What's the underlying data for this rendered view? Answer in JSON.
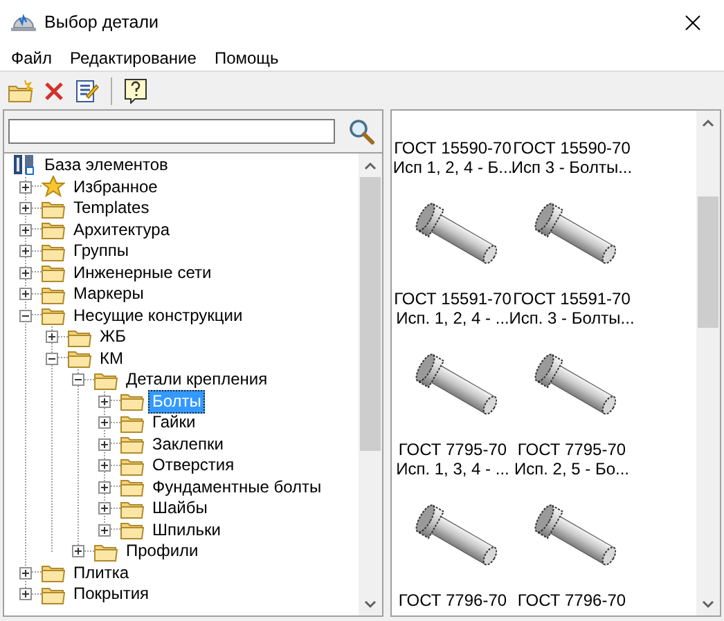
{
  "window": {
    "title": "Выбор детали"
  },
  "menu": [
    "Файл",
    "Редактирование",
    "Помощь"
  ],
  "tree": {
    "label": "База элементов",
    "kind": "root",
    "expanded": true,
    "selected": false,
    "children": [
      {
        "label": "Избранное",
        "kind": "favorites",
        "expanded": false,
        "selected": false
      },
      {
        "label": "Templates",
        "kind": "folder",
        "expanded": false,
        "selected": false
      },
      {
        "label": "Архитектура",
        "kind": "folder",
        "expanded": false,
        "selected": false
      },
      {
        "label": "Группы",
        "kind": "folder",
        "expanded": false,
        "selected": false
      },
      {
        "label": "Инженерные сети",
        "kind": "folder",
        "expanded": false,
        "selected": false
      },
      {
        "label": "Маркеры",
        "kind": "folder",
        "expanded": false,
        "selected": false
      },
      {
        "label": "Несущие конструкции",
        "kind": "folder",
        "expanded": true,
        "selected": false,
        "children": [
          {
            "label": "ЖБ",
            "kind": "folder",
            "expanded": false,
            "selected": false
          },
          {
            "label": "КМ",
            "kind": "folder",
            "expanded": true,
            "selected": false,
            "children": [
              {
                "label": "Детали крепления",
                "kind": "folder",
                "expanded": true,
                "selected": false,
                "children": [
                  {
                    "label": "Болты",
                    "kind": "folder",
                    "expanded": false,
                    "selected": true
                  },
                  {
                    "label": "Гайки",
                    "kind": "folder",
                    "expanded": false,
                    "selected": false
                  },
                  {
                    "label": "Заклепки",
                    "kind": "folder",
                    "expanded": false,
                    "selected": false
                  },
                  {
                    "label": "Отверстия",
                    "kind": "folder",
                    "expanded": false,
                    "selected": false
                  },
                  {
                    "label": "Фундаментные болты",
                    "kind": "folder",
                    "expanded": false,
                    "selected": false
                  },
                  {
                    "label": "Шайбы",
                    "kind": "folder",
                    "expanded": false,
                    "selected": false
                  },
                  {
                    "label": "Шпильки",
                    "kind": "folder",
                    "expanded": false,
                    "selected": false
                  }
                ]
              },
              {
                "label": "Профили",
                "kind": "folder",
                "expanded": false,
                "selected": false
              }
            ]
          }
        ]
      },
      {
        "label": "Плитка",
        "kind": "folder",
        "expanded": false,
        "selected": false
      },
      {
        "label": "Покрытия",
        "kind": "folder",
        "expanded": false,
        "selected": false
      }
    ]
  },
  "gallery": [
    {
      "title": "ГОСТ 15590-70",
      "subtitle": "Исп 1, 2, 4 - Б...",
      "picture": false
    },
    {
      "title": "ГОСТ 15590-70",
      "subtitle": "Исп 3 - Болты...",
      "picture": false
    },
    {
      "title": "ГОСТ 15591-70",
      "subtitle": "Исп. 1, 2, 4 - ...",
      "picture": true
    },
    {
      "title": "ГОСТ 15591-70",
      "subtitle": "Исп. 3 - Болты...",
      "picture": true
    },
    {
      "title": "ГОСТ 7795-70",
      "subtitle": "Исп. 1, 3, 4 - ...",
      "picture": true
    },
    {
      "title": "ГОСТ 7795-70",
      "subtitle": "Исп. 2, 5 - Бо...",
      "picture": true
    },
    {
      "title": "ГОСТ 7796-70",
      "picture": true
    },
    {
      "title": "ГОСТ 7796-70",
      "picture": true
    }
  ]
}
